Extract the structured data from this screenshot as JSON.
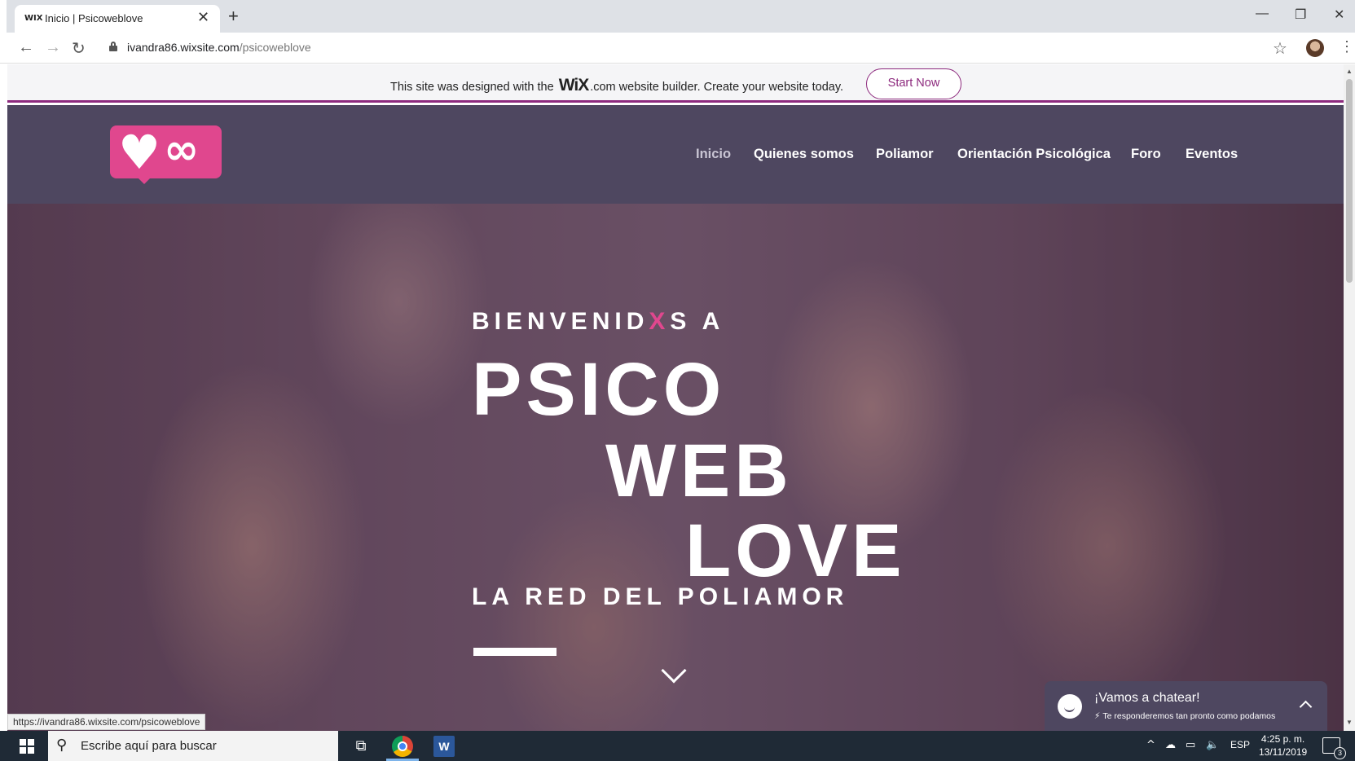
{
  "browser": {
    "tab": {
      "favicon": "WIX",
      "title": "Inicio | Psicoweblove"
    },
    "close_glyph": "✕",
    "newtab_glyph": "+",
    "window_controls": {
      "minimize": "—",
      "restore": "❐",
      "close": "✕"
    },
    "nav": {
      "back": "←",
      "forward": "→",
      "reload": "↻"
    },
    "url": {
      "domain": "ivandra86.wixsite.com",
      "path": "/psicoweblove"
    },
    "star_glyph": "☆",
    "menu_glyph": "⋮"
  },
  "wix_banner": {
    "before": "This site was designed with the ",
    "brand": "WiX",
    "after": ".com website builder. Create your website today.",
    "button": "Start Now",
    "accent": "#8d2a7e"
  },
  "site": {
    "logo": {
      "heart": "♥",
      "infinity": "∞",
      "color": "#e0478e"
    },
    "nav": [
      {
        "label": "Inicio",
        "active": true
      },
      {
        "label": "Quienes somos"
      },
      {
        "label": "Poliamor"
      },
      {
        "label": "Orientación Psicológica"
      },
      {
        "label": "Foro"
      },
      {
        "label": "Eventos"
      }
    ],
    "header_bg": "#4e4760"
  },
  "hero": {
    "welcome_prefix": "BIENVENID",
    "welcome_x": "X",
    "welcome_suffix": "S A",
    "line1": "PSICO",
    "line2": "WEB",
    "line3": "LOVE",
    "tagline": "LA RED DEL POLIAMOR"
  },
  "chat": {
    "title": "¡Vamos a chatear!",
    "subtitle": "Te responderemos tan pronto como podamos",
    "bolt": "⚡"
  },
  "status_url": "https://ivandra86.wixsite.com/psicoweblove",
  "taskbar": {
    "search_placeholder": "Escribe aquí para buscar",
    "search_glyph": "⚲",
    "taskview_glyph": "⧉",
    "word_letter": "W",
    "tray": {
      "chevron": "^",
      "cloud": "☁",
      "network": "▭",
      "volume": "🔈",
      "lang": "ESP"
    },
    "time": "4:25 p. m.",
    "date": "13/11/2019",
    "notifications": "3"
  }
}
